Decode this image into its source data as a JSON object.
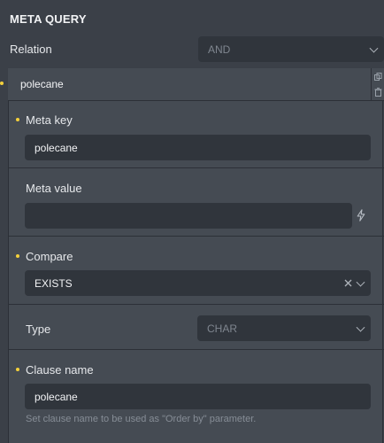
{
  "panel_title": "META QUERY",
  "relation": {
    "label": "Relation",
    "value": "AND"
  },
  "clause": {
    "header": "polecane",
    "meta_key": {
      "label": "Meta key",
      "value": "polecane"
    },
    "meta_value": {
      "label": "Meta value",
      "value": ""
    },
    "compare": {
      "label": "Compare",
      "value": "EXISTS"
    },
    "type": {
      "label": "Type",
      "value": "CHAR"
    },
    "clause_name": {
      "label": "Clause name",
      "value": "polecane",
      "hint": "Set clause name to be used as \"Order by\" parameter."
    }
  },
  "icons": {
    "copy": "copy-icon",
    "trash": "trash-icon",
    "bolt": "bolt-icon",
    "clear": "close-icon",
    "chevron": "chevron-down-icon"
  },
  "colors": {
    "background": "#3b4048",
    "panel": "#454b53",
    "field": "#30353c",
    "required_dot": "#f4d13b"
  }
}
